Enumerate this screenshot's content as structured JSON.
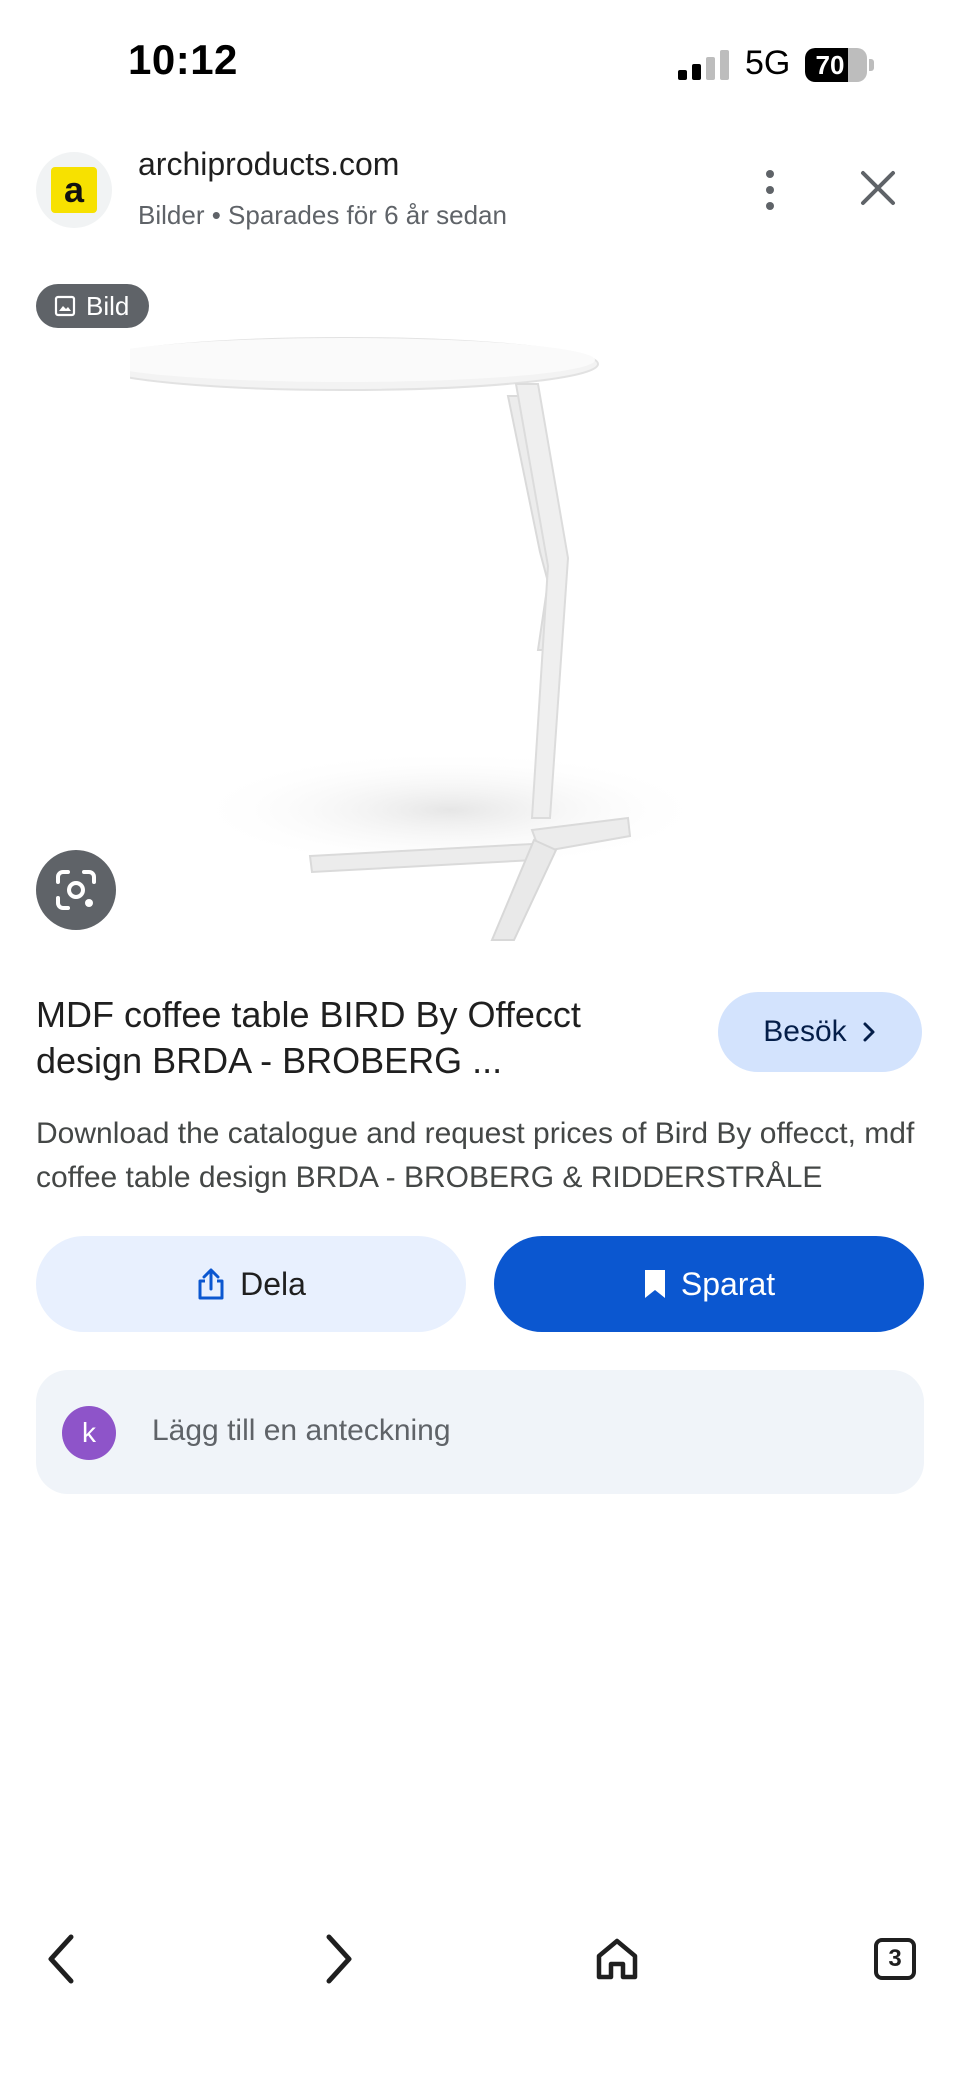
{
  "status_bar": {
    "time": "10:12",
    "network": "5G",
    "battery_level": "70",
    "battery_fraction": 0.7
  },
  "header": {
    "site_logo_letter": "a",
    "site_name": "archiproducts.com",
    "subtitle": "Bilder • Sparades för 6 år sedan",
    "more_icon": "more-vert-icon",
    "close_icon": "close-icon"
  },
  "media": {
    "badge_label": "Bild",
    "badge_icon": "image-icon",
    "lens_icon": "google-lens-icon"
  },
  "result": {
    "title": "MDF coffee table BIRD By Offecct design BRDA - BROBERG ...",
    "visit_label": "Besök",
    "description": "Download the catalogue and request prices of Bird By offecct, mdf coffee table design BRDA - BROBERG & RIDDERSTRÅLE"
  },
  "actions": {
    "share_label": "Dela",
    "saved_label": "Sparat"
  },
  "note": {
    "avatar_letter": "k",
    "placeholder": "Lägg till en anteckning"
  },
  "bottom_nav": {
    "tab_count": "3"
  },
  "colors": {
    "accent": "#0b57d0",
    "visit_bg": "#d3e3fd",
    "share_bg": "#e8f0fe",
    "logo_yellow": "#f7e100",
    "avatar": "#8e54c9"
  }
}
